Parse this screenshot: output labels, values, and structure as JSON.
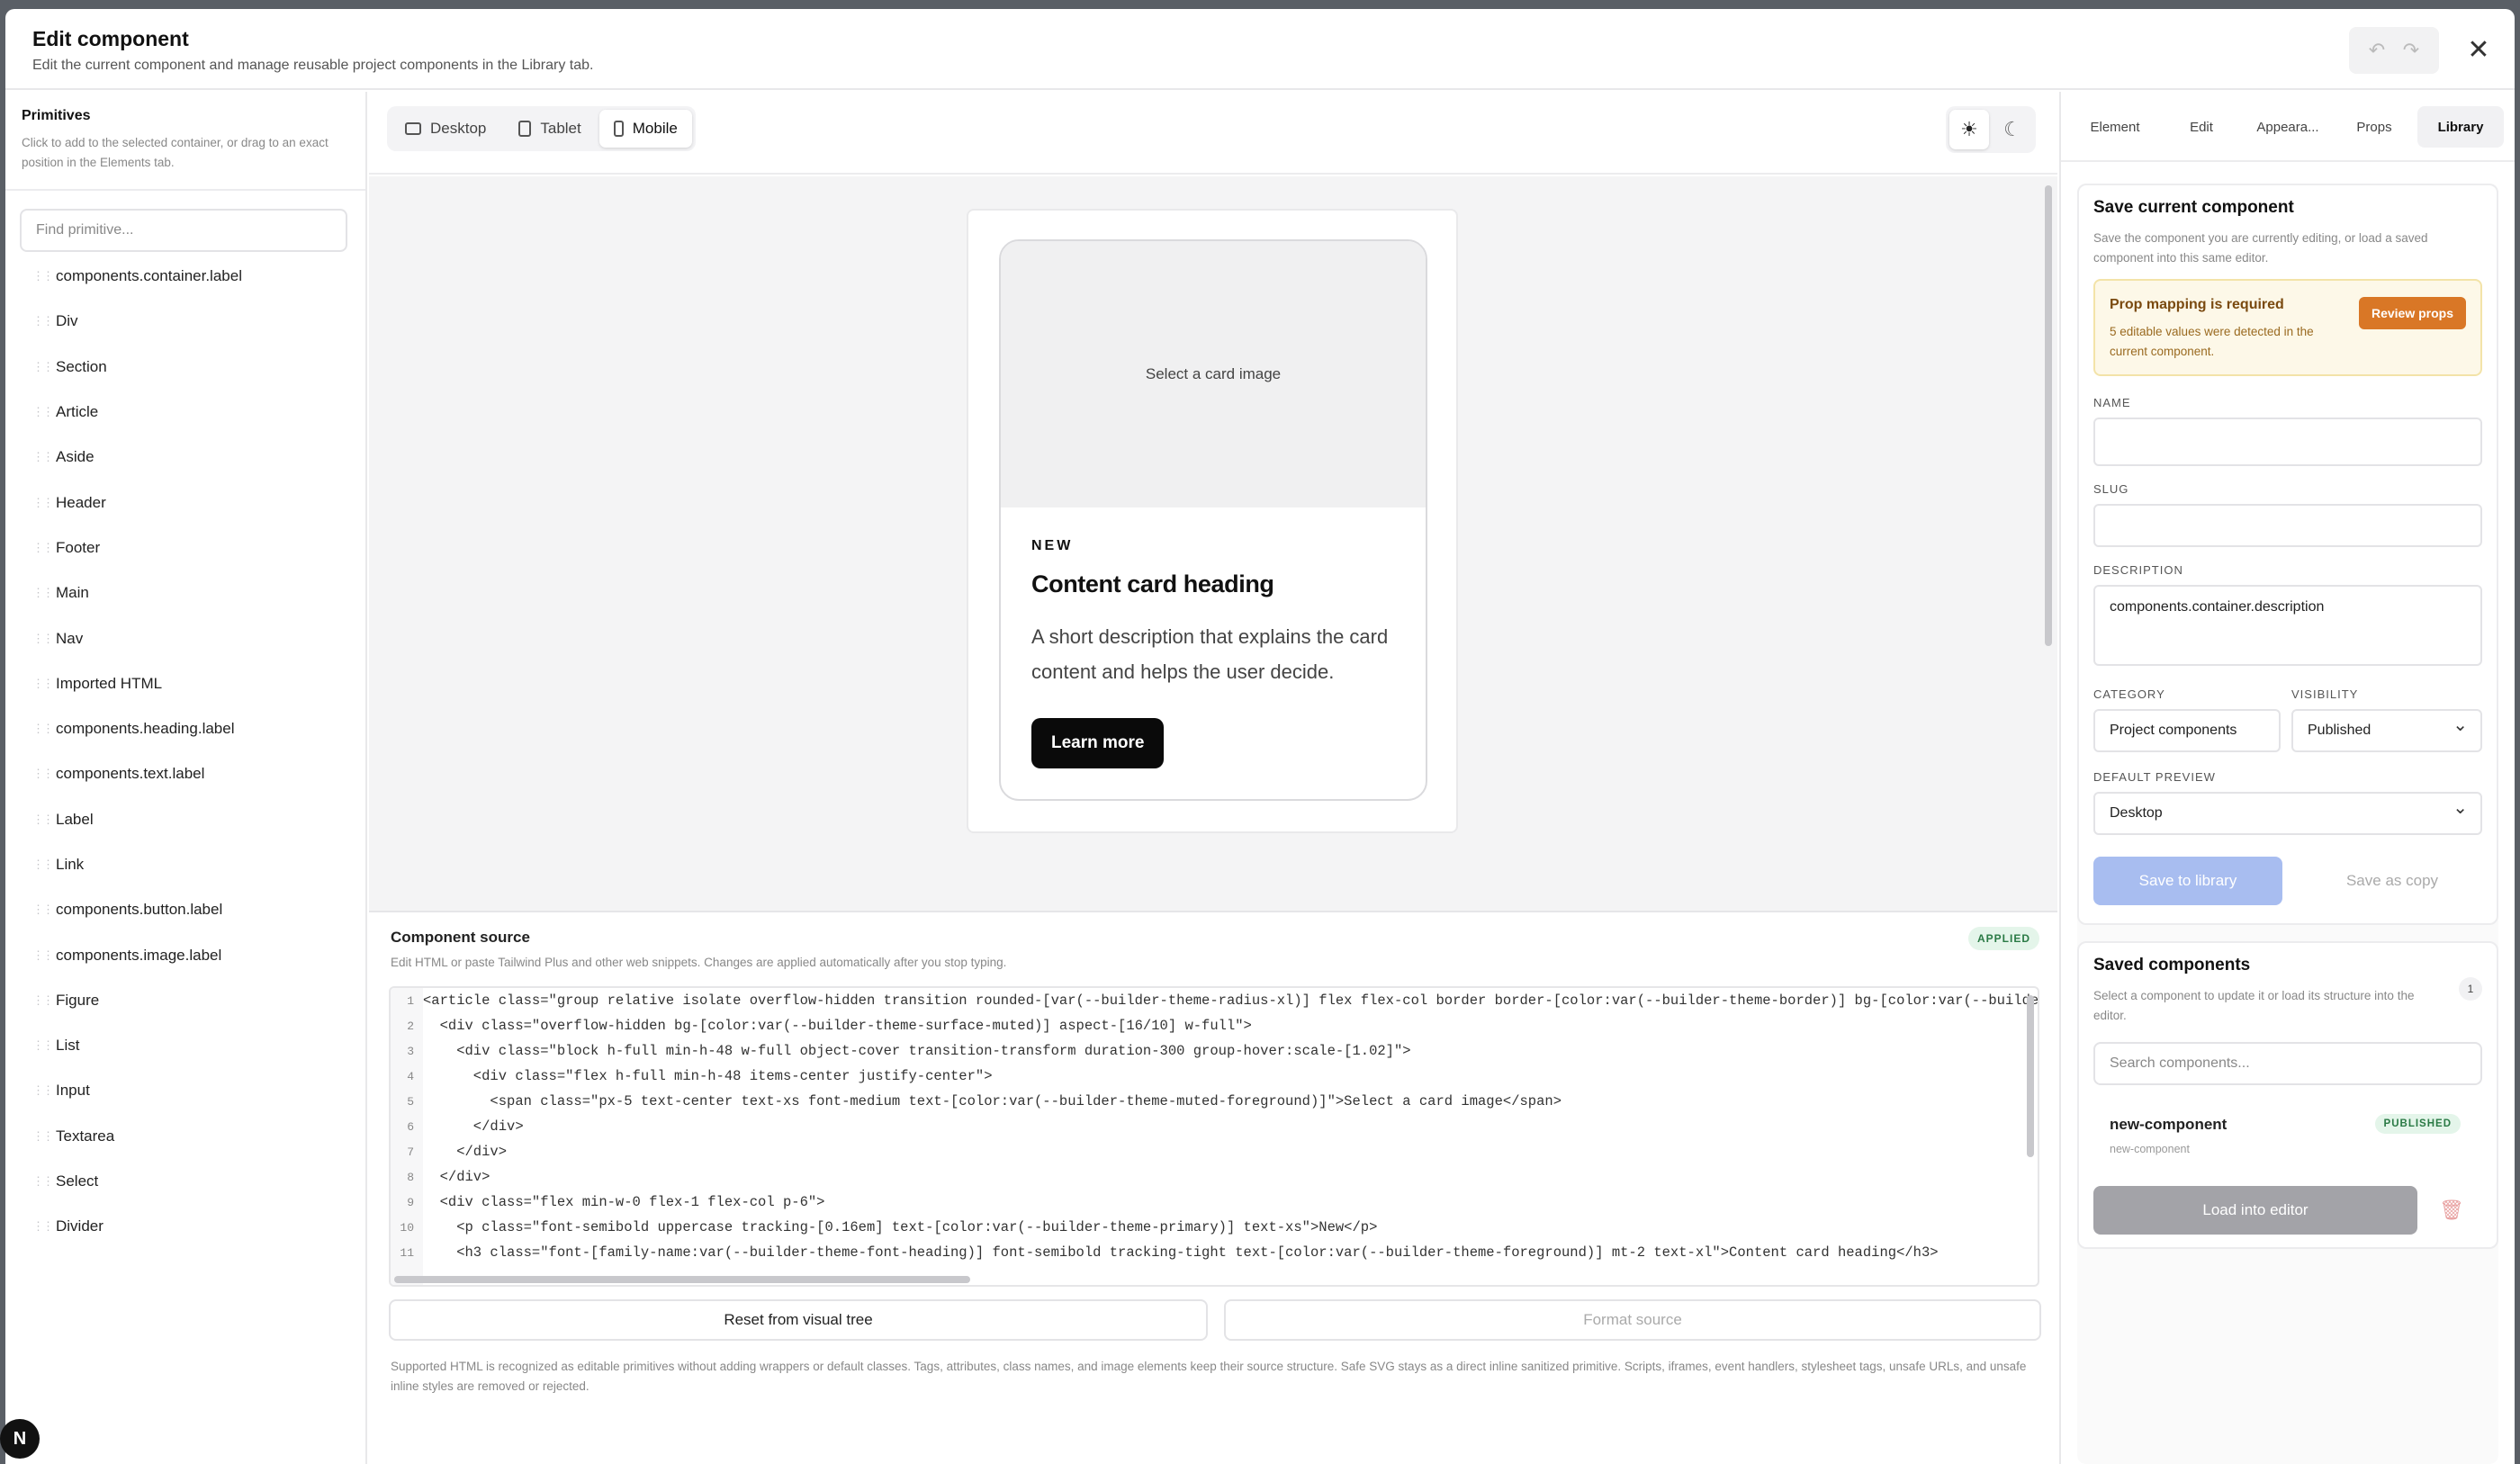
{
  "header": {
    "title": "Edit component",
    "subtitle": "Edit the current component and manage reusable project components in the Library tab.",
    "undo_icon": "undo-icon",
    "redo_icon": "redo-icon",
    "close_icon": "close-icon"
  },
  "primitives": {
    "title": "Primitives",
    "help": "Click to add to the selected container, or drag to an exact position in the Elements tab.",
    "search_placeholder": "Find primitive...",
    "items": [
      "components.container.label",
      "Div",
      "Section",
      "Article",
      "Aside",
      "Header",
      "Footer",
      "Main",
      "Nav",
      "Imported HTML",
      "components.heading.label",
      "components.text.label",
      "Label",
      "Link",
      "components.button.label",
      "components.image.label",
      "Figure",
      "List",
      "Input",
      "Textarea",
      "Select",
      "Divider"
    ]
  },
  "toolbar": {
    "devices": [
      "Desktop",
      "Tablet",
      "Mobile"
    ],
    "active_device": "Mobile",
    "theme_icons": [
      "sun-icon",
      "moon-icon"
    ]
  },
  "preview": {
    "image_placeholder": "Select a card image",
    "kicker": "NEW",
    "heading": "Content card heading",
    "description": "A short description that explains the card content and helps the user decide.",
    "cta": "Learn more"
  },
  "source": {
    "title": "Component source",
    "help": "Edit HTML or paste Tailwind Plus and other web snippets. Changes are applied automatically after you stop typing.",
    "status": "APPLIED",
    "lines": [
      "<article class=\"group relative isolate overflow-hidden transition rounded-[var(--builder-theme-radius-xl)] flex flex-col border border-[color:var(--builder-theme-border)] bg-[color:var(--builde",
      "  <div class=\"overflow-hidden bg-[color:var(--builder-theme-surface-muted)] aspect-[16/10] w-full\">",
      "    <div class=\"block h-full min-h-48 w-full object-cover transition-transform duration-300 group-hover:scale-[1.02]\">",
      "      <div class=\"flex h-full min-h-48 items-center justify-center\">",
      "        <span class=\"px-5 text-center text-xs font-medium text-[color:var(--builder-theme-muted-foreground)]\">Select a card image</span>",
      "      </div>",
      "    </div>",
      "  </div>",
      "  <div class=\"flex min-w-0 flex-1 flex-col p-6\">",
      "    <p class=\"font-semibold uppercase tracking-[0.16em] text-[color:var(--builder-theme-primary)] text-xs\">New</p>",
      "    <h3 class=\"font-[family-name:var(--builder-theme-font-heading)] font-semibold tracking-tight text-[color:var(--builder-theme-foreground)] mt-2 text-xl\">Content card heading</h3>"
    ],
    "reset_label": "Reset from visual tree",
    "format_label": "Format source",
    "footnote": "Supported HTML is recognized as editable primitives without adding wrappers or default classes. Tags, attributes, class names, and image elements keep their source structure. Safe SVG stays as a direct inline sanitized primitive. Scripts, iframes, event handlers, stylesheet tags, unsafe URLs, and unsafe inline styles are removed or rejected."
  },
  "right_tabs": [
    "Element",
    "Edit",
    "Appeara...",
    "Props",
    "Library"
  ],
  "active_right_tab": "Library",
  "save_component": {
    "title": "Save current component",
    "help": "Save the component you are currently editing, or load a saved component into this same editor.",
    "warning_title": "Prop mapping is required",
    "warning_text": "5 editable values were detected in the current component.",
    "review_label": "Review props",
    "name_label": "NAME",
    "name_value": "",
    "slug_label": "SLUG",
    "slug_value": "",
    "description_label": "DESCRIPTION",
    "description_value": "components.container.description",
    "category_label": "CATEGORY",
    "category_value": "Project components",
    "visibility_label": "VISIBILITY",
    "visibility_value": "Published",
    "preview_label": "DEFAULT PREVIEW",
    "preview_value": "Desktop",
    "save_label": "Save to library",
    "copy_label": "Save as copy"
  },
  "saved_components": {
    "title": "Saved components",
    "help": "Select a component to update it or load its structure into the editor.",
    "count": "1",
    "search_placeholder": "Search components...",
    "item_name": "new-component",
    "item_slug": "new-component",
    "item_status": "PUBLISHED",
    "load_label": "Load into editor",
    "delete_icon": "trash-icon"
  },
  "colors": {
    "accent_primary": "#a8bdf0",
    "warning_button": "#d97726",
    "success_badge": "#2a7a45"
  }
}
